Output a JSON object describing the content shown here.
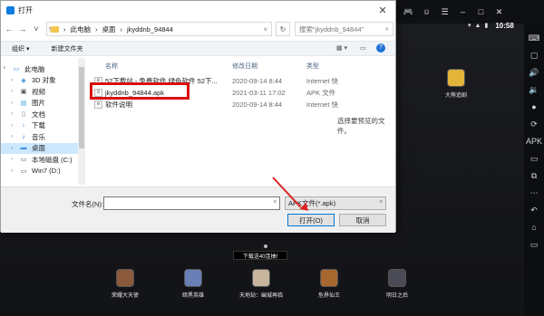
{
  "dialog": {
    "title": "打开",
    "close_glyph": "✕",
    "breadcrumb": [
      "此电脑",
      "桌面",
      "jkyddnb_94844"
    ],
    "search_placeholder": "搜索\"jkyddnb_94844\"",
    "toolbar": {
      "organize": "组织 ▾",
      "new_folder": "新建文件夹"
    },
    "nav_tree": [
      {
        "label": "此电脑",
        "icon": "computer-icon",
        "level": 0
      },
      {
        "label": "3D 对象",
        "icon": "3d-objects-icon",
        "level": 1
      },
      {
        "label": "视频",
        "icon": "video-icon",
        "level": 1
      },
      {
        "label": "图片",
        "icon": "picture-icon",
        "level": 1
      },
      {
        "label": "文档",
        "icon": "document-icon",
        "level": 1
      },
      {
        "label": "下载",
        "icon": "download-icon",
        "level": 1
      },
      {
        "label": "音乐",
        "icon": "music-icon",
        "level": 1
      },
      {
        "label": "桌面",
        "icon": "desktop-icon",
        "level": 1,
        "selected": true
      },
      {
        "label": "本地磁盘 (C:)",
        "icon": "drive-icon",
        "level": 1
      },
      {
        "label": "Win7 (D:)",
        "icon": "drive-icon",
        "level": 1
      }
    ],
    "columns": {
      "name": "名称",
      "date": "修改日期",
      "type": "类型"
    },
    "files": [
      {
        "name": "52下载站 - 免费软件 绿色软件 52下...",
        "date": "2020-09-14 8:44",
        "type": "Internet 快",
        "icon": "internet-shortcut-icon"
      },
      {
        "name": "jkyddnb_94844.apk",
        "date": "2021-03-11 17:02",
        "type": "APK 文件",
        "icon": "apk-file-icon"
      },
      {
        "name": "软件说明",
        "date": "2020-09-14 8:44",
        "type": "Internet 快",
        "icon": "internet-shortcut-icon"
      }
    ],
    "preview_text": "选择要预览的文件。",
    "filename_label": "文件名(N):",
    "filename_value": "",
    "filetype_value": "APK文件(*.apk)",
    "open_label": "打开(O)",
    "cancel_label": "取消"
  },
  "emulator": {
    "time": "10:58",
    "desktop_app": "大熊追剧",
    "download_text": "下载送40连抽!",
    "dock_apps": [
      "荣耀大天使",
      "暗黑英雄",
      "天地劫：幽城再临",
      "危界仙王",
      "明日之后"
    ]
  },
  "colors": {
    "accent": "#0078d7",
    "highlight": "#d90f0f",
    "selection": "#cce8ff"
  }
}
